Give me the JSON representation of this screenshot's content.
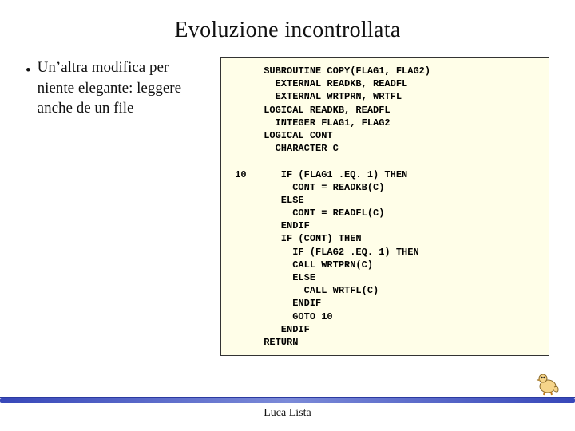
{
  "title": "Evoluzione incontrollata",
  "bullet_text": "Un’altra modifica per niente elegante: leggere anche de un file",
  "code": "      SUBROUTINE COPY(FLAG1, FLAG2)\n        EXTERNAL READKB, READFL\n        EXTERNAL WRTPRN, WRTFL\n      LOGICAL READKB, READFL\n        INTEGER FLAG1, FLAG2\n      LOGICAL CONT\n        CHARACTER C\n\n 10      IF (FLAG1 .EQ. 1) THEN\n           CONT = READKB(C)\n         ELSE\n           CONT = READFL(C)\n         ENDIF\n         IF (CONT) THEN\n           IF (FLAG2 .EQ. 1) THEN\n           CALL WRTPRN(C)\n           ELSE\n             CALL WRTFL(C)\n           ENDIF\n           GOTO 10\n         ENDIF\n      RETURN",
  "footer": "Luca Lista"
}
